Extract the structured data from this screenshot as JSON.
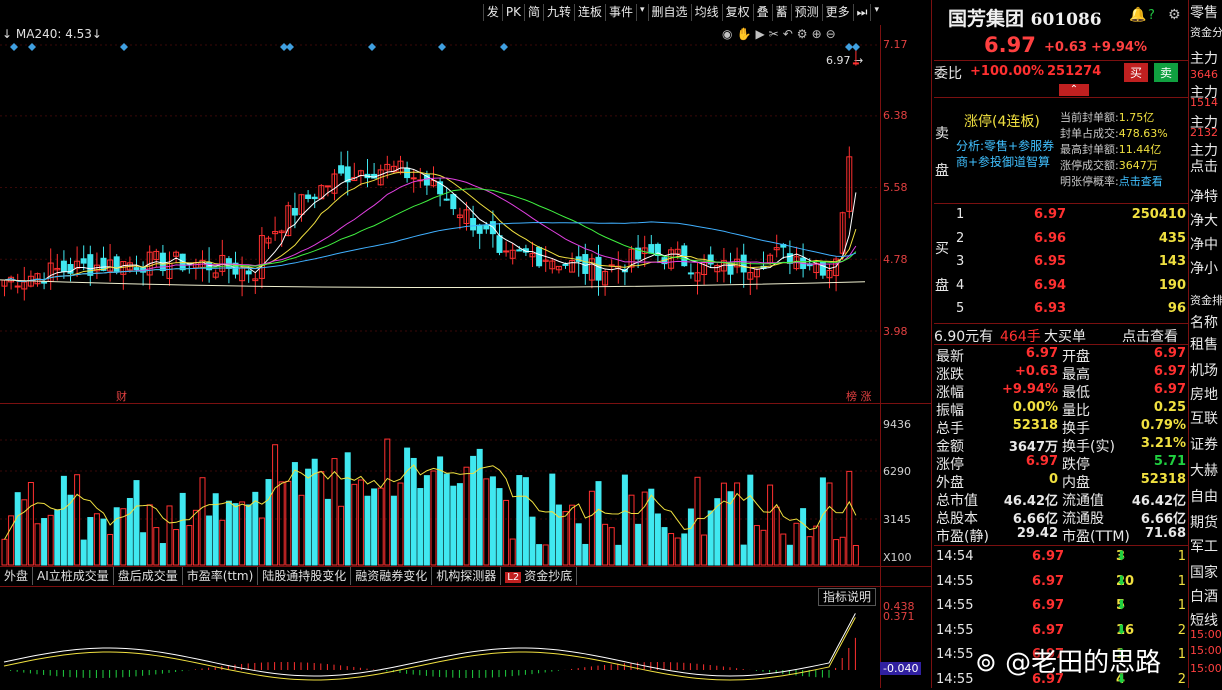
{
  "toolbar": {
    "buttons": [
      "发",
      "PK",
      "简",
      "九转",
      "连板",
      "事件",
      "▾",
      "删自选",
      "均线",
      "复权",
      "叠",
      "蓄",
      "预测",
      "更多",
      "⏭",
      "▾"
    ]
  },
  "chart": {
    "ma_label": "MA240: 4.53",
    "y_labels_main": [
      "7.17",
      "6.38",
      "5.58",
      "4.78",
      "3.98"
    ],
    "current_price_marker": "6.97",
    "markers": {
      "fin": "财",
      "rank": "榜",
      "up": "涨"
    },
    "y_labels_vol": [
      "9436",
      "6290",
      "3145"
    ],
    "vol_unit": "X100",
    "y_labels_ind": [
      "0.438",
      "0.371",
      "-0.040"
    ]
  },
  "chart_data": {
    "type": "candlestick",
    "price_axis_ticks": [
      7.17,
      6.38,
      5.58,
      4.78,
      3.98
    ],
    "volume_axis_ticks": [
      9436,
      6290,
      3145
    ],
    "last_close": 6.97,
    "ma240": 4.53
  },
  "tabs": [
    "外盘",
    "AI立桩成交量",
    "盘后成交量",
    "市盈率(ttm)",
    "陆股通持股变化",
    "融资融券变化",
    "机构探测器",
    "资金抄底"
  ],
  "tab_l2": "L2",
  "indicator_btn": "指标说明",
  "stock": {
    "name": "国芳集团",
    "code": "601086",
    "price": "6.97",
    "change": "+0.63",
    "change_pct": "+9.94%",
    "webi_label": "委比",
    "webi": "+100.00%",
    "webi_vol": "251274",
    "buy_btn": "买",
    "sell_btn": "卖"
  },
  "limit_info": {
    "sell_label": "卖盘",
    "title": "涨停(4连板)",
    "analysis": "分析:零售+参服券商+参投御道智算",
    "items": [
      {
        "k": "当前封单额:",
        "v": "1.75亿"
      },
      {
        "k": "封单占成交:",
        "v": "478.63%"
      },
      {
        "k": "最高封单额:",
        "v": "11.44亿"
      },
      {
        "k": "涨停成交额:",
        "v": "3647万"
      },
      {
        "k": "明张停概率:",
        "v": "点击查看"
      }
    ]
  },
  "bids": {
    "label": "买盘",
    "rows": [
      {
        "lvl": "1",
        "price": "6.97",
        "vol": "250410"
      },
      {
        "lvl": "2",
        "price": "6.96",
        "vol": "435"
      },
      {
        "lvl": "3",
        "price": "6.95",
        "vol": "143"
      },
      {
        "lvl": "4",
        "price": "6.94",
        "vol": "190"
      },
      {
        "lvl": "5",
        "price": "6.93",
        "vol": "96"
      }
    ]
  },
  "bigorder": {
    "price": "6.90元有",
    "vol": "464手",
    "label": "大买单",
    "link": "点击查看"
  },
  "stats": [
    {
      "k1": "最新",
      "v1": "6.97",
      "k2": "开盘",
      "v2": "6.97"
    },
    {
      "k1": "涨跌",
      "v1": "+0.63",
      "k2": "最高",
      "v2": "6.97"
    },
    {
      "k1": "涨幅",
      "v1": "+9.94%",
      "k2": "最低",
      "v2": "6.97"
    },
    {
      "k1": "振幅",
      "v1": "0.00%",
      "k2": "量比",
      "v2": "0.25"
    },
    {
      "k1": "总手",
      "v1": "52318",
      "k2": "换手",
      "v2": "0.79%"
    },
    {
      "k1": "金额",
      "v1": "3647万",
      "k2": "换手(实)",
      "v2": "3.21%"
    },
    {
      "k1": "涨停",
      "v1": "6.97",
      "k2": "跌停",
      "v2": "5.71"
    },
    {
      "k1": "外盘",
      "v1": "0",
      "k2": "内盘",
      "v2": "52318"
    },
    {
      "k1": "总市值",
      "v1": "46.42亿",
      "k2": "流通值",
      "v2": "46.42亿"
    },
    {
      "k1": "总股本",
      "v1": "6.66亿",
      "k2": "流通股",
      "v2": "6.66亿"
    },
    {
      "k1": "市盈(静)",
      "v1": "29.42",
      "k2": "市盈(TTM)",
      "v2": "71.68"
    }
  ],
  "ticks": [
    {
      "t": "14:54",
      "p": "6.97",
      "v": "3",
      "x": "1"
    },
    {
      "t": "14:55",
      "p": "6.97",
      "v": "20",
      "x": "1"
    },
    {
      "t": "14:55",
      "p": "6.97",
      "v": "5",
      "x": "1"
    },
    {
      "t": "14:55",
      "p": "6.97",
      "v": "16",
      "x": "2"
    },
    {
      "t": "14:55",
      "p": "6.97",
      "v": "1",
      "x": "1"
    },
    {
      "t": "14:55",
      "p": "6.97",
      "v": "4",
      "x": "2"
    }
  ],
  "far_right": {
    "items": [
      "零售",
      "资金分",
      "主力",
      "3646",
      "主力",
      "1514",
      "主力",
      "2132",
      "主力",
      "点击",
      "净特",
      "净大",
      "净中",
      "净小",
      "资金排",
      "名称",
      "租售",
      "机场",
      "房地",
      "互联",
      "证券",
      "大赫",
      "自由",
      "期货",
      "军工",
      "国家",
      "白酒",
      "短线",
      "15:00",
      "15:00",
      "15:00"
    ]
  },
  "watermark": "@老田的思路"
}
